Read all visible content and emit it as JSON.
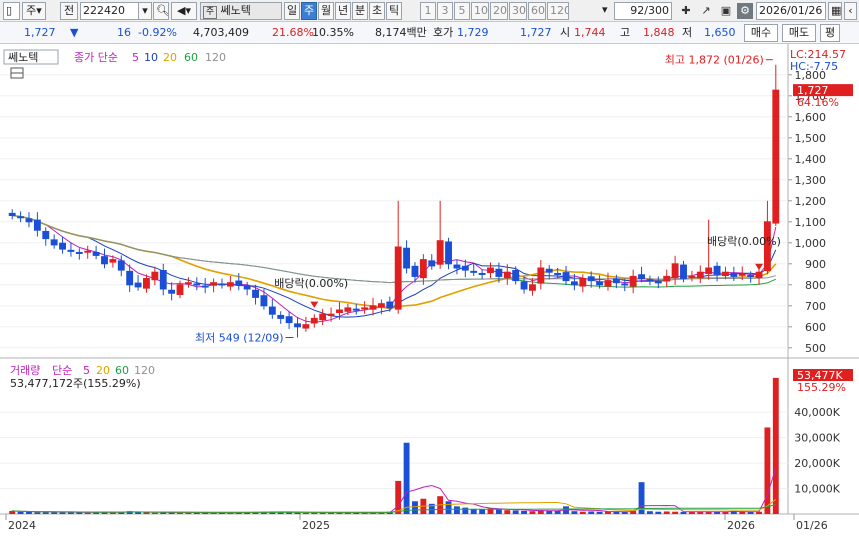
{
  "toolbar": {
    "market": "주",
    "prev_label": "전",
    "code": "222420",
    "stock_name": "쎄노텍",
    "name_prefix": "주",
    "periods": [
      "일",
      "주",
      "월",
      "년",
      "분",
      "초",
      "틱"
    ],
    "active_period": "주",
    "intervals": [
      "1",
      "3",
      "5",
      "10",
      "20",
      "30",
      "60",
      "120"
    ],
    "count": "92",
    "count_total": "/300",
    "date": "2026/01/26"
  },
  "quote": {
    "price": "1,727",
    "change": "16",
    "change_pct": "-0.92%",
    "volume": "4,703,409",
    "vol_ratio": "21.68%",
    "turnover": "10.35%",
    "amount": "8,174백만",
    "bid_label": "호가",
    "bid": "1,729",
    "ask": "1,727",
    "open_label": "시",
    "open": "1,744",
    "high_label": "고",
    "high": "1,848",
    "low_label": "저",
    "low": "1,650",
    "buy_label": "매수",
    "sell_label": "매도",
    "eval_label": "평"
  },
  "price_panel": {
    "name_tag": "쎄노텍",
    "legend_label": "종가 단순",
    "ma_periods": [
      "5",
      "10",
      "20",
      "60",
      "120"
    ],
    "lc": "LC:214.57",
    "hc": "HC:-7.75",
    "last_price": "1,727",
    "last_pct": "64.16%",
    "high_annotation": "최고 1,872 (01/26)",
    "low_annotation": "최저 549 (12/09)",
    "dividend_label_1": "배당락(0.00%)",
    "dividend_label_2": "배당락(0.00%)",
    "y_ticks": [
      "1,800",
      "1,700",
      "1,600",
      "1,500",
      "1,400",
      "1,300",
      "1,200",
      "1,100",
      "1,000",
      "900",
      "800",
      "700",
      "600",
      "500"
    ]
  },
  "volume_panel": {
    "legend_label": "거래량",
    "legend_ma": "단순",
    "ma_periods": [
      "5",
      "20",
      "60",
      "120"
    ],
    "summary": "53,477,172주(155.29%)",
    "last_value": "53,477K",
    "last_pct": "155.29%",
    "y_ticks": [
      "40,000K",
      "30,000K",
      "20,000K",
      "10,000K"
    ]
  },
  "x_axis": {
    "labels": [
      "2024",
      "2025",
      "2026",
      "01/26"
    ]
  },
  "colors": {
    "up": "#e02020",
    "down": "#1a4fd6",
    "ma5": "#c020c0",
    "ma10": "#1a3fc0",
    "ma20": "#e0a000",
    "ma60": "#20a040",
    "ma120": "#909090"
  },
  "chart_data": {
    "type": "candlestick",
    "ylim": [
      480,
      1880
    ],
    "weekly_closes": [
      1130,
      1120,
      1100,
      1060,
      1020,
      990,
      970,
      960,
      950,
      960,
      940,
      900,
      920,
      870,
      800,
      790,
      830,
      860,
      780,
      760,
      800,
      810,
      800,
      790,
      810,
      800,
      810,
      800,
      780,
      740,
      700,
      660,
      640,
      620,
      600,
      610,
      640,
      660,
      660,
      680,
      690,
      680,
      690,
      700,
      710,
      690,
      980,
      880,
      840,
      920,
      890,
      1010,
      900,
      880,
      870,
      860,
      850,
      880,
      840,
      860,
      820,
      780,
      800,
      880,
      860,
      850,
      820,
      800,
      830,
      820,
      800,
      820,
      810,
      800,
      840,
      830,
      820,
      810,
      840,
      900,
      830,
      840,
      860,
      880,
      850,
      860,
      840,
      850,
      840,
      860,
      1100,
      1727
    ],
    "weekly_volumes_k": [
      1200,
      900,
      800,
      700,
      900,
      600,
      700,
      800,
      600,
      500,
      700,
      900,
      600,
      800,
      1100,
      700,
      600,
      500,
      700,
      600,
      500,
      600,
      500,
      400,
      500,
      600,
      500,
      600,
      700,
      800,
      900,
      1000,
      800,
      700,
      600,
      500,
      600,
      700,
      500,
      400,
      500,
      600,
      500,
      400,
      500,
      900,
      13000,
      28000,
      5000,
      6000,
      4000,
      7000,
      5000,
      3000,
      2500,
      2000,
      1800,
      2200,
      1800,
      1500,
      1400,
      1200,
      1100,
      1500,
      1300,
      1200,
      3000,
      1100,
      900,
      1000,
      900,
      1000,
      900,
      800,
      1200,
      12500,
      1100,
      900,
      1000,
      900,
      800,
      900,
      1000,
      900,
      800,
      900,
      1200,
      900,
      800,
      900,
      34000,
      53477
    ]
  }
}
